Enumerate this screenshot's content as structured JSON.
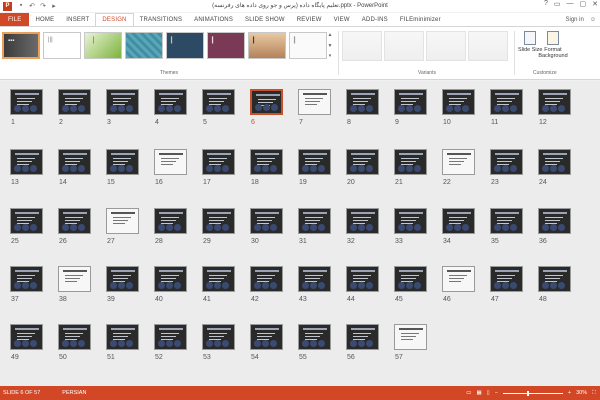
{
  "titlebar": {
    "app_icon": "P",
    "qat_icons": [
      "save-icon",
      "undo-icon",
      "redo-icon",
      "start-icon"
    ],
    "title": "تعلیم پایگاه داده (پرس و جو روی داده های رفرنسه).pptx - PowerPoint",
    "controls": [
      "?",
      "▭",
      "—",
      "▢",
      "✕"
    ]
  },
  "tabs": [
    {
      "label": "FILE"
    },
    {
      "label": "HOME"
    },
    {
      "label": "INSERT"
    },
    {
      "label": "DESIGN"
    },
    {
      "label": "TRANSITIONS"
    },
    {
      "label": "ANIMATIONS"
    },
    {
      "label": "SLIDE SHOW"
    },
    {
      "label": "REVIEW"
    },
    {
      "label": "VIEW"
    },
    {
      "label": "ADD-INS"
    },
    {
      "label": "FILEminimizer"
    }
  ],
  "active_tab": "DESIGN",
  "signin": "Sign in",
  "ribbon": {
    "themes_label": "Themes",
    "variants_label": "Variants",
    "customize_label": "Customize",
    "slide_size_label": "Slide Size",
    "format_bg_label": "Format Background"
  },
  "slides": {
    "count": 57,
    "selected": 6,
    "light": [
      7,
      16,
      22,
      27,
      38,
      46,
      57
    ]
  },
  "status": {
    "slide_info": "SLIDE 6 OF 57",
    "language": "PERSIAN",
    "zoom": "30%"
  },
  "colors": {
    "accent": "#d24726",
    "selected_border": "#c9512a"
  }
}
